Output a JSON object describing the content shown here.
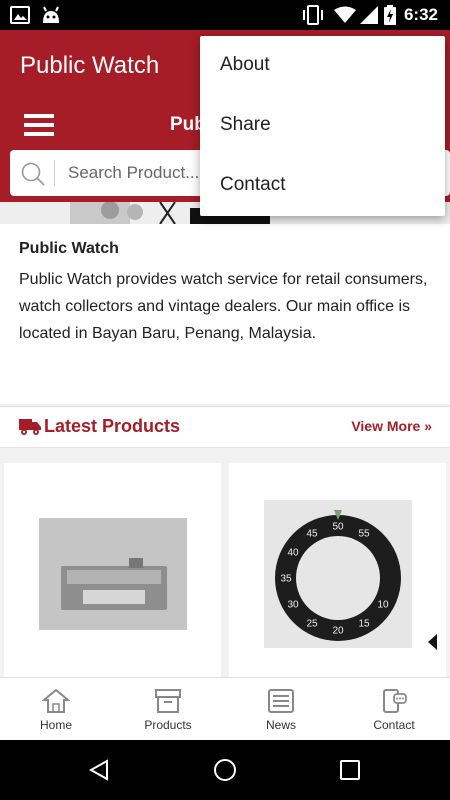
{
  "status_bar": {
    "time": "6:32"
  },
  "app_bar": {
    "title": "Public Watch"
  },
  "sub_bar": {
    "title": "Pub",
    "search_placeholder": "Search Product..."
  },
  "overflow_menu": {
    "items": [
      "About",
      "Share",
      "Contact"
    ]
  },
  "about": {
    "name": "Public Watch",
    "description": "Public Watch provides watch service for retail consumers, watch collectors and vintage dealers. Our main office is located in Bayan Baru, Penang, Malaysia."
  },
  "latest": {
    "heading": "Latest Products",
    "view_more": "View More »"
  },
  "bezel_numbers": [
    "55",
    "50",
    "45",
    "40",
    "35",
    "30",
    "25",
    "20",
    "15",
    "10"
  ],
  "bottom_nav": {
    "items": [
      "Home",
      "Products",
      "News",
      "Contact"
    ]
  },
  "colors": {
    "accent": "#a61d27"
  }
}
